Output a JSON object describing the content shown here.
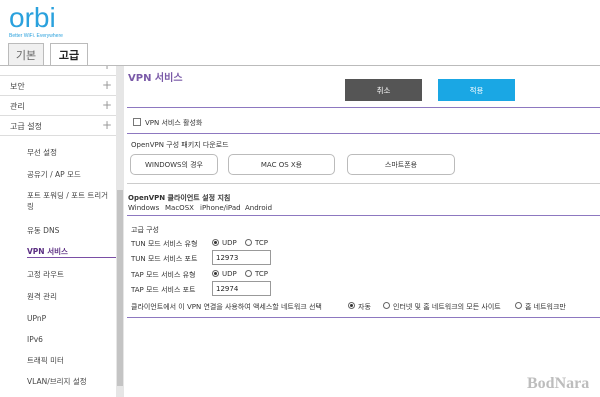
{
  "brand": {
    "logo": "orbi",
    "tagline": "Better WiFi. Everywhere"
  },
  "tabs": {
    "basic": "기본",
    "advanced": "고급"
  },
  "sidebar": {
    "groups": [
      {
        "label": "보안",
        "expand": "+"
      },
      {
        "label": "관리",
        "expand": "+"
      },
      {
        "label": "고급 설정",
        "expand": "+"
      }
    ],
    "items": [
      "무선 설정",
      "공유기 / AP 모드",
      "포트 포워딩 / 포트 트리거링",
      "유동 DNS",
      "VPN 서비스",
      "고정 라우트",
      "원격 관리",
      "UPnP",
      "IPv6",
      "트래픽 미터",
      "VLAN/브리지 설정"
    ],
    "active_item": "VPN 서비스"
  },
  "page": {
    "title": "VPN 서비스",
    "cancel_label": "취소",
    "apply_label": "적용",
    "enable_vpn_label": "VPN 서비스 활성화",
    "download_heading": "OpenVPN 구성 패키지 다운로드",
    "download_buttons": [
      "WINDOWS의 경우",
      "MAC OS X용",
      "스마트폰용"
    ],
    "client_heading": "OpenVPN 클라이언트 설정 지침",
    "client_links": [
      "Windows",
      "MacOSX",
      "iPhone/iPad",
      "Android"
    ],
    "advanced_heading": "고급 구성",
    "tun_type_label": "TUN 모드 서비스 유형",
    "tun_port_label": "TUN 모드 서비스 포트",
    "tun_port_value": "12973",
    "tap_type_label": "TAP 모드 서비스 유형",
    "tap_port_label": "TAP 모드 서비스 포트",
    "tap_port_value": "12974",
    "udp_label": "UDP",
    "tcp_label": "TCP",
    "client_access_label": "클라이언트에서 이 VPN 연결을 사용하여 액세스할 네트워크 선택",
    "access_options": [
      "자동",
      "인터넷 및 홈 네트워크의 모든 사이트",
      "홈 네트워크만"
    ]
  },
  "watermark": "BodNara",
  "colors": {
    "accent": "#1aa7e4",
    "purple": "#7a5aa8",
    "cancel": "#555555"
  }
}
